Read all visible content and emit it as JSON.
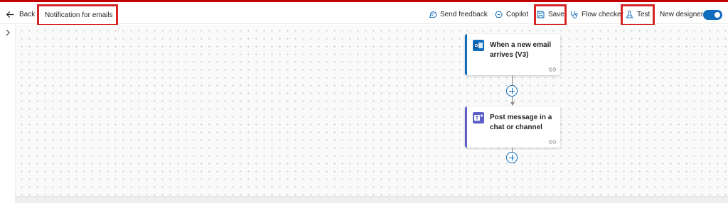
{
  "header": {
    "back_label": "Back",
    "flow_title": "Notification for emails",
    "toolbar": {
      "send_feedback": "Send feedback",
      "copilot": "Copilot",
      "save": "Save",
      "flow_checker": "Flow checker",
      "test": "Test",
      "new_designer": "New designer"
    },
    "new_designer_on": true
  },
  "flow": {
    "steps": [
      {
        "label": "When a new email arrives (V3)",
        "icon": "outlook-icon",
        "accent": "#0f6cbd"
      },
      {
        "label": "Post message in a chat or channel",
        "icon": "teams-icon",
        "accent": "#5b5fc7"
      }
    ]
  },
  "colors": {
    "highlight": "#d62424",
    "accent": "#0f6cbd",
    "teams": "#5b5fc7"
  }
}
